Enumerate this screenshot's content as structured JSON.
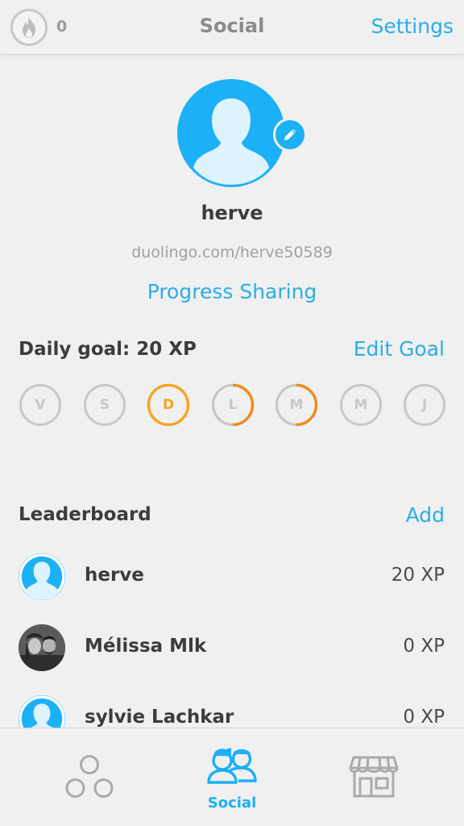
{
  "topbar": {
    "streak_count": "0",
    "title": "Social",
    "settings_label": "Settings"
  },
  "profile": {
    "username": "herve",
    "url": "duolingo.com/herve50589",
    "progress_sharing_label": "Progress Sharing"
  },
  "daily_goal": {
    "label": "Daily goal: 20 XP",
    "edit_label": "Edit Goal",
    "days": [
      {
        "letter": "V",
        "progress": 0
      },
      {
        "letter": "S",
        "progress": 0
      },
      {
        "letter": "D",
        "progress": 1.0
      },
      {
        "letter": "L",
        "progress": 0.5
      },
      {
        "letter": "M",
        "progress": 0.5
      },
      {
        "letter": "M",
        "progress": 0
      },
      {
        "letter": "J",
        "progress": 0
      }
    ]
  },
  "leaderboard": {
    "label": "Leaderboard",
    "add_label": "Add",
    "rows": [
      {
        "name": "herve",
        "xp": "20 XP"
      },
      {
        "name": "Mélissa Mlk",
        "xp": "0 XP"
      },
      {
        "name": "sylvie Lachkar",
        "xp": "0 XP"
      }
    ]
  },
  "bottom_nav": {
    "items": [
      {
        "icon": "skills-icon",
        "label": ""
      },
      {
        "icon": "social-icon",
        "label": "Social"
      },
      {
        "icon": "store-icon",
        "label": ""
      }
    ]
  },
  "colors": {
    "accent": "#1cb0f6",
    "link": "#2aaee8",
    "goal_ring": "#f5a623",
    "goal_ring_dark": "#f08a1c",
    "inactive": "#c8c8c8"
  }
}
